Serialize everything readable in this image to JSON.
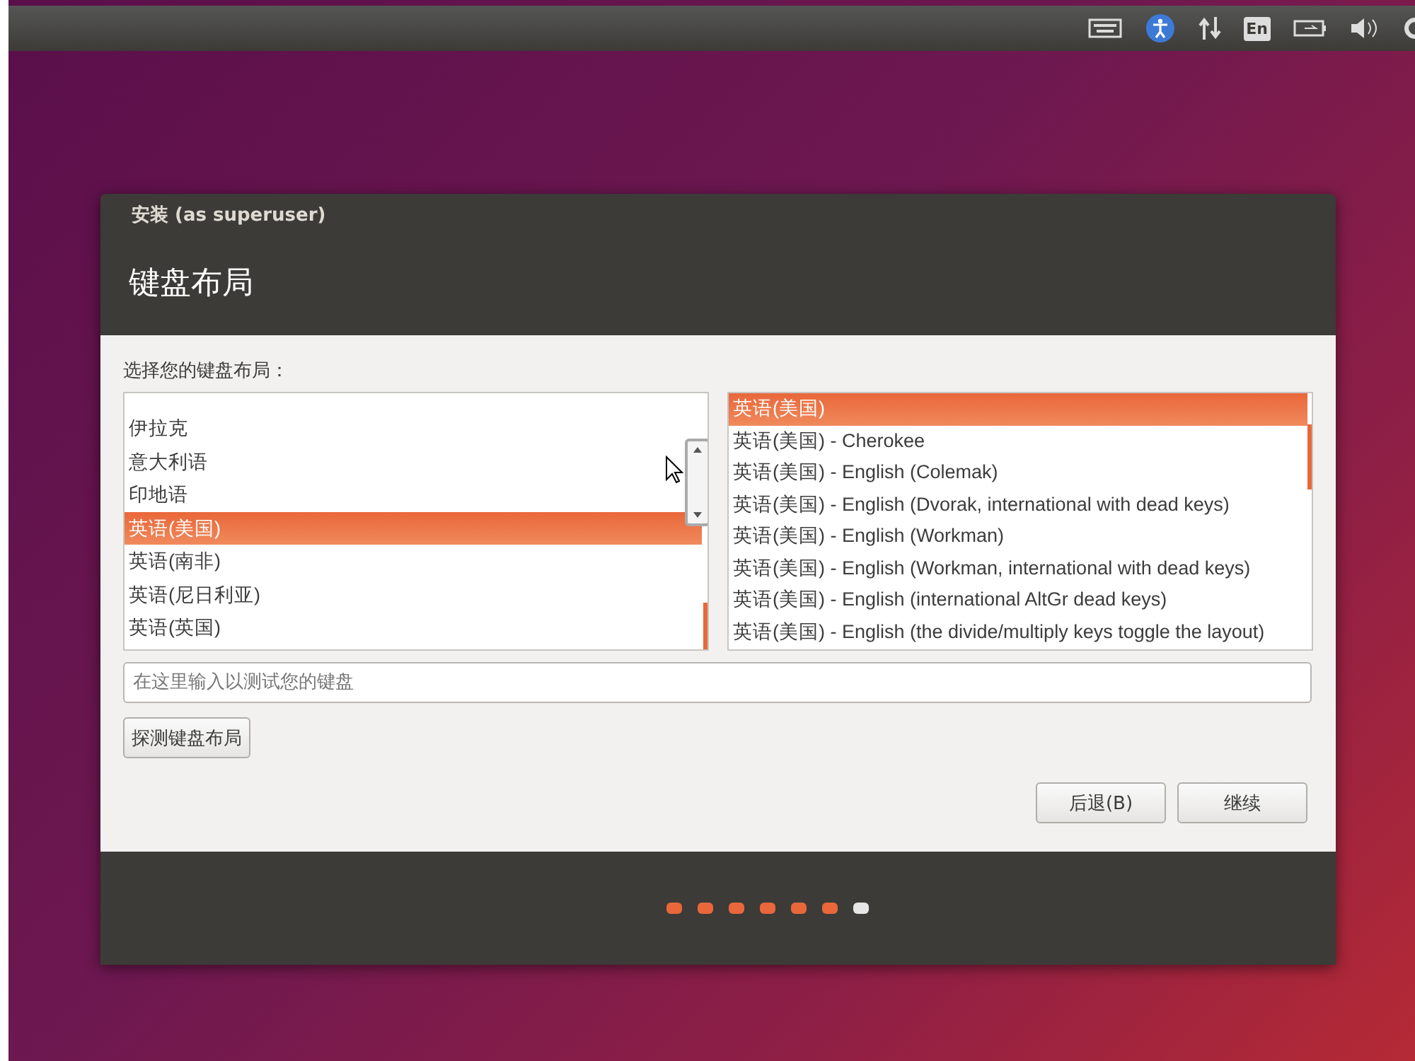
{
  "top_panel": {
    "keyboard_indicator": "En"
  },
  "window": {
    "title": "安装 (as superuser)",
    "heading": "键盘布局"
  },
  "layout_label": "选择您的键盘布局：",
  "layouts": [
    {
      "label": "伊拉克",
      "selected": false
    },
    {
      "label": "意大利语",
      "selected": false
    },
    {
      "label": "印地语",
      "selected": false
    },
    {
      "label": "英语(美国)",
      "selected": true
    },
    {
      "label": "英语(南非)",
      "selected": false
    },
    {
      "label": "英语(尼日利亚)",
      "selected": false
    },
    {
      "label": "英语(英国)",
      "selected": false
    }
  ],
  "variants": [
    {
      "label": "英语(美国)",
      "selected": true
    },
    {
      "label": "英语(美国) - Cherokee",
      "selected": false
    },
    {
      "label": "英语(美国) - English (Colemak)",
      "selected": false
    },
    {
      "label": "英语(美国) - English (Dvorak, international with dead keys)",
      "selected": false
    },
    {
      "label": "英语(美国) - English (Workman)",
      "selected": false
    },
    {
      "label": "英语(美国) - English (Workman, international with dead keys)",
      "selected": false
    },
    {
      "label": "英语(美国) - English (international AltGr dead keys)",
      "selected": false
    },
    {
      "label": "英语(美国) - English (the divide/multiply keys toggle the layout)",
      "selected": false
    }
  ],
  "test_field": {
    "placeholder": "在这里输入以测试您的键盘"
  },
  "detect_button": "探测键盘布局",
  "buttons": [
    "后退(B)",
    "继续"
  ],
  "steps": [
    {
      "current": false
    },
    {
      "current": false
    },
    {
      "current": false
    },
    {
      "current": false
    },
    {
      "current": false
    },
    {
      "current": false
    },
    {
      "current": true
    }
  ]
}
